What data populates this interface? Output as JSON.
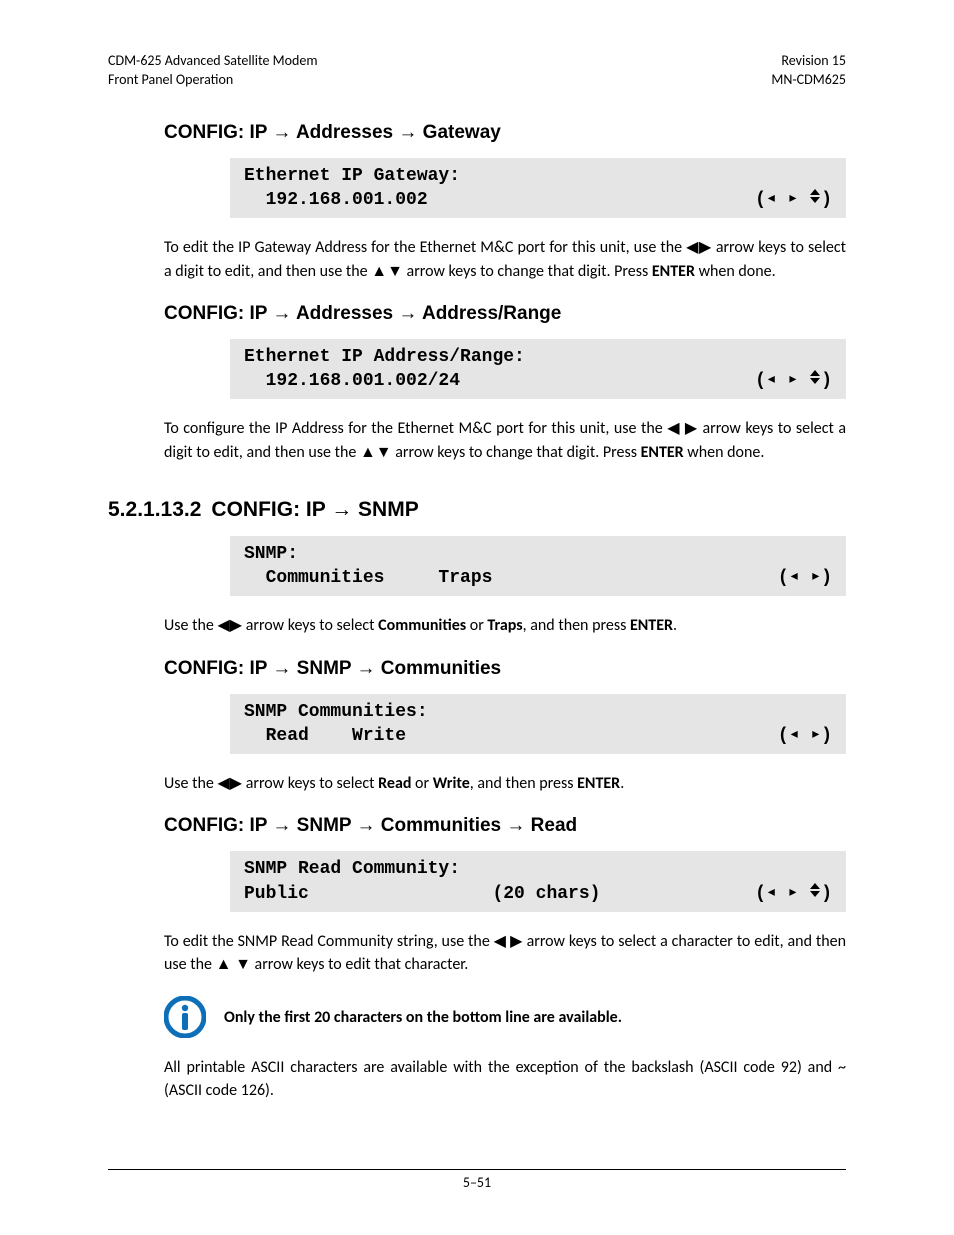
{
  "header": {
    "left1": "CDM-625 Advanced Satellite Modem",
    "left2": "Front Panel Operation",
    "right1": "Revision 15",
    "right2": "MN-CDM625"
  },
  "glyph": {
    "rarr": "→",
    "ltri": "◀",
    "rtri": "▶",
    "utri": "▲",
    "dtri": "▼"
  },
  "sec1": {
    "title_pre": "CONFIG: IP ",
    "title_mid1": " Addresses ",
    "title_end": " Gateway",
    "lcd_l1": "Ethernet IP Gateway:",
    "lcd_l2": "  192.168.001.002",
    "nav_has_updown": true,
    "para_a": "To edit the IP Gateway Address for the Ethernet M&C port for this unit, use the ",
    "para_b": " arrow keys to select a digit to edit, and then use the ",
    "para_c": " arrow keys to change that digit. Press ",
    "para_enter": "ENTER",
    "para_d": " when done."
  },
  "sec2": {
    "title_pre": "CONFIG: IP ",
    "title_mid1": " Addresses ",
    "title_end": " Address/Range",
    "lcd_l1": "Ethernet IP Address/Range:",
    "lcd_l2": "  192.168.001.002/24",
    "nav_has_updown": true,
    "para_a": "To configure the IP Address for the Ethernet M&C port for this unit, use the ",
    "para_b": " arrow keys to select a digit to edit, and then use the ",
    "para_c": " arrow keys to change that digit. Press ",
    "para_enter": "ENTER",
    "para_d": " when done."
  },
  "sec3": {
    "num": "5.2.1.13.2",
    "title_pre": "CONFIG: IP ",
    "title_end": " SNMP",
    "lcd_l1": "SNMP:",
    "lcd_l2": "  Communities     Traps",
    "nav_has_updown": false,
    "para_a": "Use the ",
    "para_b": " arrow keys to select ",
    "opt1": "Communities",
    "mid": " or ",
    "opt2": "Traps",
    "para_c": ", and then press ",
    "para_enter": "ENTER",
    "para_d": "."
  },
  "sec4": {
    "title_pre": "CONFIG: IP ",
    "title_mid1": " SNMP ",
    "title_end": " Communities",
    "lcd_l1": "SNMP Communities:",
    "lcd_l2": "  Read    Write",
    "nav_has_updown": false,
    "para_a": "Use the ",
    "para_b": " arrow keys to select ",
    "opt1": "Read",
    "mid": " or ",
    "opt2": "Write",
    "para_c": ", and then press ",
    "para_enter": "ENTER",
    "para_d": "."
  },
  "sec5": {
    "title_pre": "CONFIG: IP ",
    "title_mid1": " SNMP ",
    "title_mid2": " Communities ",
    "title_end": " Read",
    "lcd_l1": "SNMP Read Community:",
    "lcd_l2": "Public                 (20 chars)",
    "nav_has_updown": true,
    "para_a": "To edit the SNMP Read Community string, use the ",
    "para_b": " arrow keys to select a character to edit, and then use the ",
    "para_c": " arrow keys to edit that character."
  },
  "note": "Only the first 20 characters on the bottom line are available.",
  "tail": {
    "a": "All printable ASCII characters are available with the exception of the backslash (ASCII code 92) and ~ (ASCII code 126)."
  },
  "footer": "5–51"
}
